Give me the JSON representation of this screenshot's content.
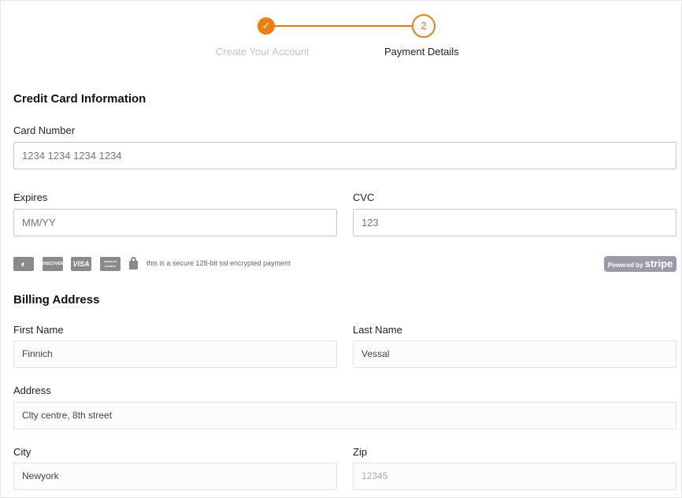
{
  "stepper": {
    "steps": [
      {
        "label": "Create Your Account",
        "icon": "check-icon",
        "state": "complete"
      },
      {
        "label": "Payment Details",
        "number": "2",
        "state": "active"
      }
    ],
    "accent": "#f07d0e"
  },
  "card_section": {
    "title": "Credit Card Information",
    "card_number_label": "Card Number",
    "card_number_placeholder": "1234 1234 1234 1234",
    "expires_label": "Expires",
    "expires_placeholder": "MM/YY",
    "cvc_label": "CVC",
    "cvc_placeholder": "123",
    "card_brands": [
      "Mastercard",
      "DISCOVER",
      "VISA",
      "AMERICAN EXPRESS"
    ],
    "secure_text": "this is a secure 128-bit ssl encrypted payment",
    "powered_by": "Powered by",
    "stripe": "stripe"
  },
  "billing": {
    "title": "Billing Address",
    "first_name_label": "First Name",
    "first_name": "Finnich",
    "last_name_label": "Last Name",
    "last_name": "Vessal",
    "address_label": "Address",
    "address": "Clty centre, 8th street",
    "city_label": "City",
    "city": "Newyork",
    "zip_label": "Zip",
    "zip_placeholder": "12345"
  }
}
